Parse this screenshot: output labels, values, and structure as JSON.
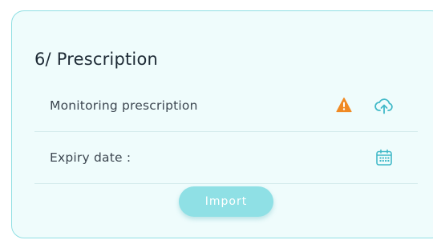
{
  "section": {
    "title": "6/ Prescription"
  },
  "rows": [
    {
      "label": "Monitoring prescription",
      "icons": [
        "warning-icon",
        "cloud-upload-icon"
      ]
    },
    {
      "label": "Expiry date :",
      "icons": [
        "calendar-icon"
      ]
    }
  ],
  "actions": {
    "import_label": "Import"
  },
  "colors": {
    "card_background": "#effcfc",
    "card_border": "#8fdfe3",
    "accent": "#41b9c8",
    "warning": "#f08a24",
    "button": "#8fe0e5",
    "divider": "#d3ebec"
  }
}
